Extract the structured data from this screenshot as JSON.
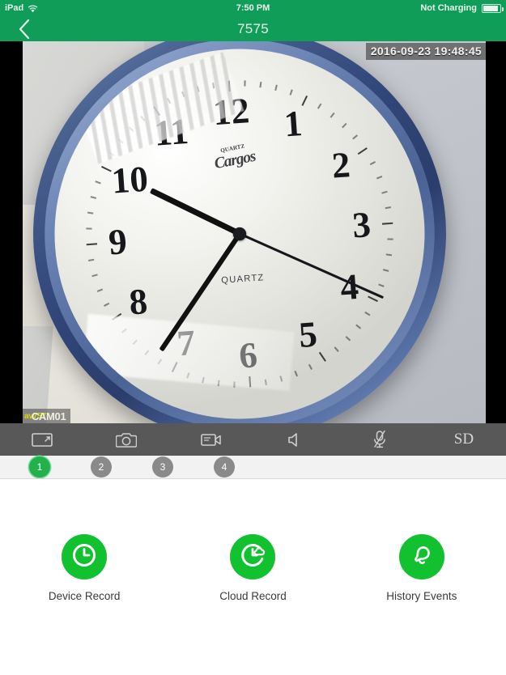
{
  "statusbar": {
    "carrier": "iPad",
    "wifi_icon": "wifi-icon",
    "time": "7:50 PM",
    "battery_text": "Not Charging",
    "battery_icon": "battery-icon"
  },
  "navbar": {
    "back_icon": "chevron-left-icon",
    "title": "7575"
  },
  "video": {
    "timestamp": "2016-09-23 19:48:45",
    "channel_id": "av757",
    "channel_name": "CAM01",
    "clock": {
      "numerals": [
        "12",
        "1",
        "2",
        "3",
        "4",
        "5",
        "6",
        "7",
        "8",
        "9",
        "10",
        "11"
      ],
      "brand": "Cargos",
      "brand_sub": "QUARTZ",
      "dial_text": "QUARTZ"
    }
  },
  "toolbar": {
    "items": [
      {
        "name": "fullscreen-icon",
        "label": "Fullscreen"
      },
      {
        "name": "snapshot-icon",
        "label": "Snapshot"
      },
      {
        "name": "record-icon",
        "label": "Record"
      },
      {
        "name": "speaker-icon",
        "label": "Speaker"
      },
      {
        "name": "microphone-muted-icon",
        "label": "Microphone"
      },
      {
        "name": "sd-quality-icon",
        "label": "SD"
      }
    ],
    "sd_label": "SD"
  },
  "channels": {
    "items": [
      {
        "label": "1",
        "active": true
      },
      {
        "label": "2",
        "active": false
      },
      {
        "label": "3",
        "active": false
      },
      {
        "label": "4",
        "active": false
      }
    ]
  },
  "actions": [
    {
      "icon": "clock-icon",
      "label": "Device Record"
    },
    {
      "icon": "cloud-clock-icon",
      "label": "Cloud Record"
    },
    {
      "icon": "bell-icon",
      "label": "History Events"
    }
  ],
  "colors": {
    "brand_green": "#0f9d58",
    "action_green": "#12c130",
    "active_channel": "#22b14c",
    "toolbar_gray": "#585858",
    "inactive_channel": "#8a8a8a"
  }
}
